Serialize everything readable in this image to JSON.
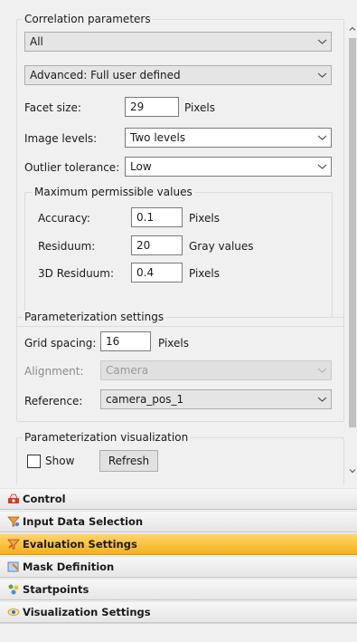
{
  "correlation": {
    "group_title": "Correlation parameters",
    "subset_select": "All",
    "mode_select": "Advanced: Full user defined",
    "facet_size_label": "Facet size:",
    "facet_size_value": "29",
    "facet_size_unit": "Pixels",
    "image_levels_label": "Image levels:",
    "image_levels_value": "Two levels",
    "outlier_label": "Outlier tolerance:",
    "outlier_value": "Low",
    "maximum": {
      "group_title": "Maximum permissible values",
      "accuracy_label": "Accuracy:",
      "accuracy_value": "0.1",
      "accuracy_unit": "Pixels",
      "residuum_label": "Residuum:",
      "residuum_value": "20",
      "residuum_unit": "Gray values",
      "residuum3d_label": "3D Residuum:",
      "residuum3d_value": "0.4",
      "residuum3d_unit": "Pixels"
    }
  },
  "parameterization": {
    "group_title": "Parameterization settings",
    "grid_spacing_label": "Grid spacing:",
    "grid_spacing_value": "16",
    "grid_spacing_unit": "Pixels",
    "alignment_label": "Alignment:",
    "alignment_value": "Camera",
    "reference_label": "Reference:",
    "reference_value": "camera_pos_1"
  },
  "visualization": {
    "group_title": "Parameterization visualization",
    "show_label": "Show",
    "show_checked": false,
    "refresh_label": "Refresh"
  },
  "nav": {
    "items": [
      {
        "label": "Control",
        "icon": "control-icon",
        "active": false
      },
      {
        "label": "Input Data Selection",
        "icon": "input-data-icon",
        "active": false
      },
      {
        "label": "Evaluation Settings",
        "icon": "evaluation-icon",
        "active": true
      },
      {
        "label": "Mask Definition",
        "icon": "mask-icon",
        "active": false
      },
      {
        "label": "Startpoints",
        "icon": "startpoints-icon",
        "active": false
      },
      {
        "label": "Visualization Settings",
        "icon": "visualization-icon",
        "active": false
      }
    ]
  },
  "colors": {
    "active_tab": "#f5b11e",
    "panel_bg": "#f0f0f0"
  }
}
